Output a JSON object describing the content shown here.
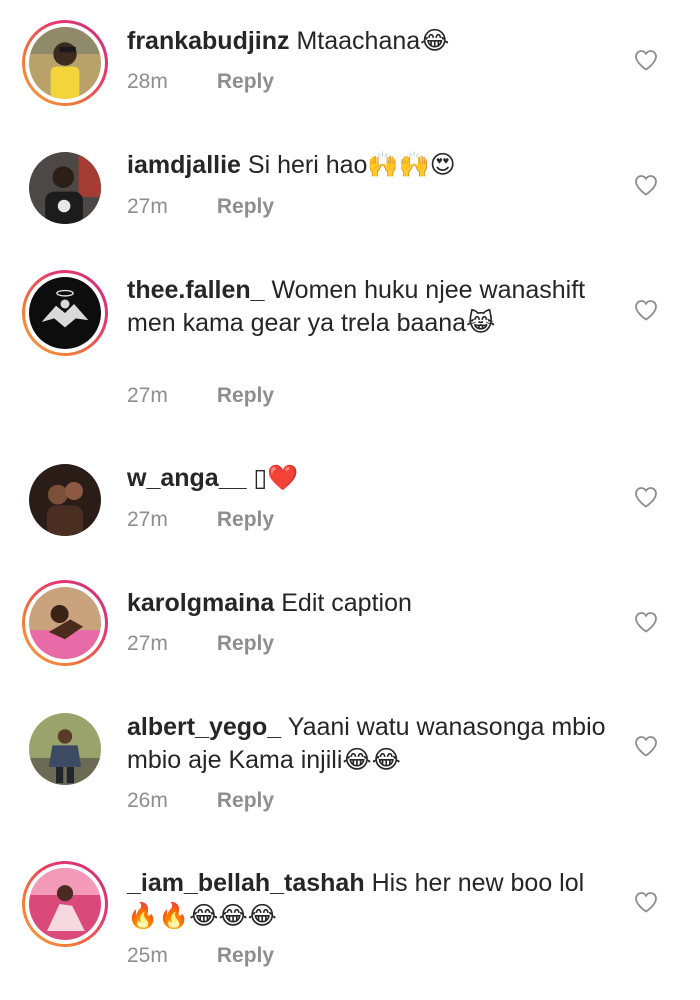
{
  "comments": [
    {
      "username": "frankabudjinz",
      "text": "Mtaachana😂",
      "time": "28m",
      "reply": "Reply"
    },
    {
      "username": "iamdjallie",
      "text": "Si heri hao🙌🙌😍",
      "time": "27m",
      "reply": "Reply"
    },
    {
      "username": "thee.fallen_",
      "text": "Women huku njee wanashift men kama gear ya trela baana😹",
      "time": "27m",
      "reply": "Reply"
    },
    {
      "username": "w_anga__",
      "text": "▯❤️",
      "time": "27m",
      "reply": "Reply"
    },
    {
      "username": "karolgmaina",
      "text": "Edit caption",
      "time": "27m",
      "reply": "Reply"
    },
    {
      "username": "albert_yego_",
      "text": "Yaani watu wanasonga mbio mbio aje Kama injili😂😂",
      "time": "26m",
      "reply": "Reply"
    },
    {
      "username": "_iam_bellah_tashah",
      "text": "His her new boo lol 🔥🔥😂😂😂",
      "time": "25m",
      "reply": "Reply"
    }
  ],
  "icons": {
    "like": "heart-outline-icon"
  },
  "colors": {
    "text": "#262626",
    "meta": "#8e8e8e",
    "story_ring_start": "#f9a13c",
    "story_ring_end": "#c6307f"
  }
}
